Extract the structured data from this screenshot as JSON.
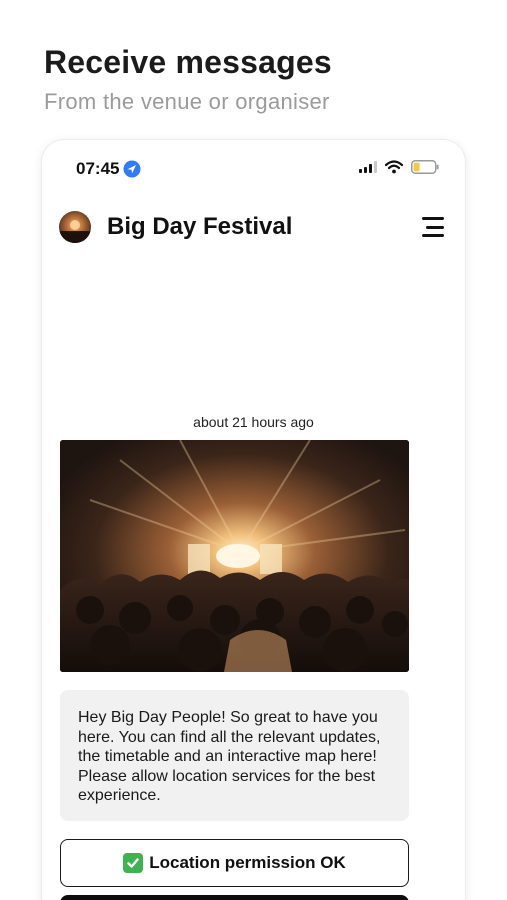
{
  "promo": {
    "headline": "Receive messages",
    "subheadline": "From the venue or organiser"
  },
  "status_bar": {
    "time": "07:45",
    "location_icon": "location-arrow-icon",
    "signal_icon": "cellular-signal-icon",
    "wifi_icon": "wifi-icon",
    "battery_icon": "battery-low-icon",
    "battery_color": "#f2c94c"
  },
  "app_header": {
    "title": "Big Day Festival",
    "avatar_icon": "festival-logo-avatar",
    "menu_icon": "hamburger-menu-icon"
  },
  "message": {
    "timestamp": "about 21 hours ago",
    "image_alt": "concert crowd stage lights",
    "text": "Hey Big Day People! So great to have you here. You can find all the relevant updates, the timetable and an interactive map here! Please allow location services for the best experience."
  },
  "actions": {
    "permission_button": {
      "label": "Location permission OK",
      "icon": "green-check-icon",
      "icon_color": "#3fb34f"
    }
  }
}
